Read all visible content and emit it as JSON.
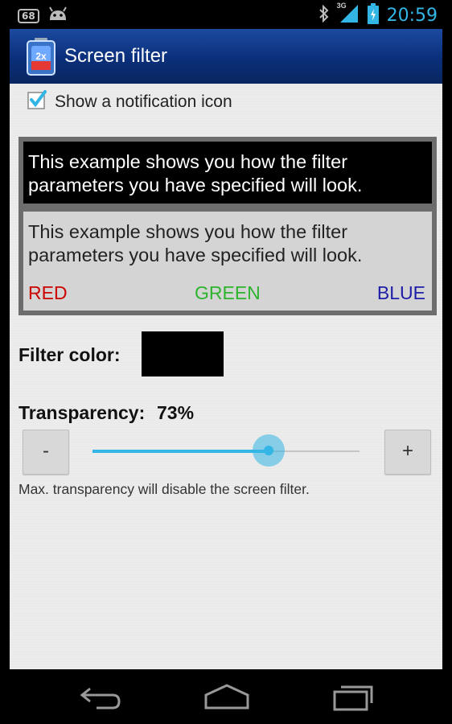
{
  "status_bar": {
    "badge": "68",
    "network": "3G",
    "time": "20:59"
  },
  "action_bar": {
    "title": "Screen filter",
    "icon": "app-battery-2x-icon",
    "icon_text": "2x"
  },
  "settings": {
    "notification_checkbox": {
      "label": "Show a notification icon",
      "checked": true
    },
    "preview": {
      "dark_text": "This example shows you how the filter parameters you have specified will look.",
      "light_text": "This example shows you how the filter parameters you have specified will look.",
      "red_label": "RED",
      "green_label": "GREEN",
      "blue_label": "BLUE"
    },
    "filter_color": {
      "label": "Filter color:",
      "value": "#000000"
    },
    "transparency": {
      "label": "Transparency:",
      "value_text": "73%",
      "slider_fraction": 0.66,
      "minus_label": "-",
      "plus_label": "+"
    },
    "hint": "Max. transparency will disable the screen filter."
  },
  "colors": {
    "accent": "#33b5e5",
    "red": "#cc0000",
    "green": "#2cb52c",
    "blue": "#1e1ea8"
  },
  "nav_bar": {
    "icons": [
      "back-icon",
      "home-icon",
      "recent-apps-icon"
    ]
  }
}
